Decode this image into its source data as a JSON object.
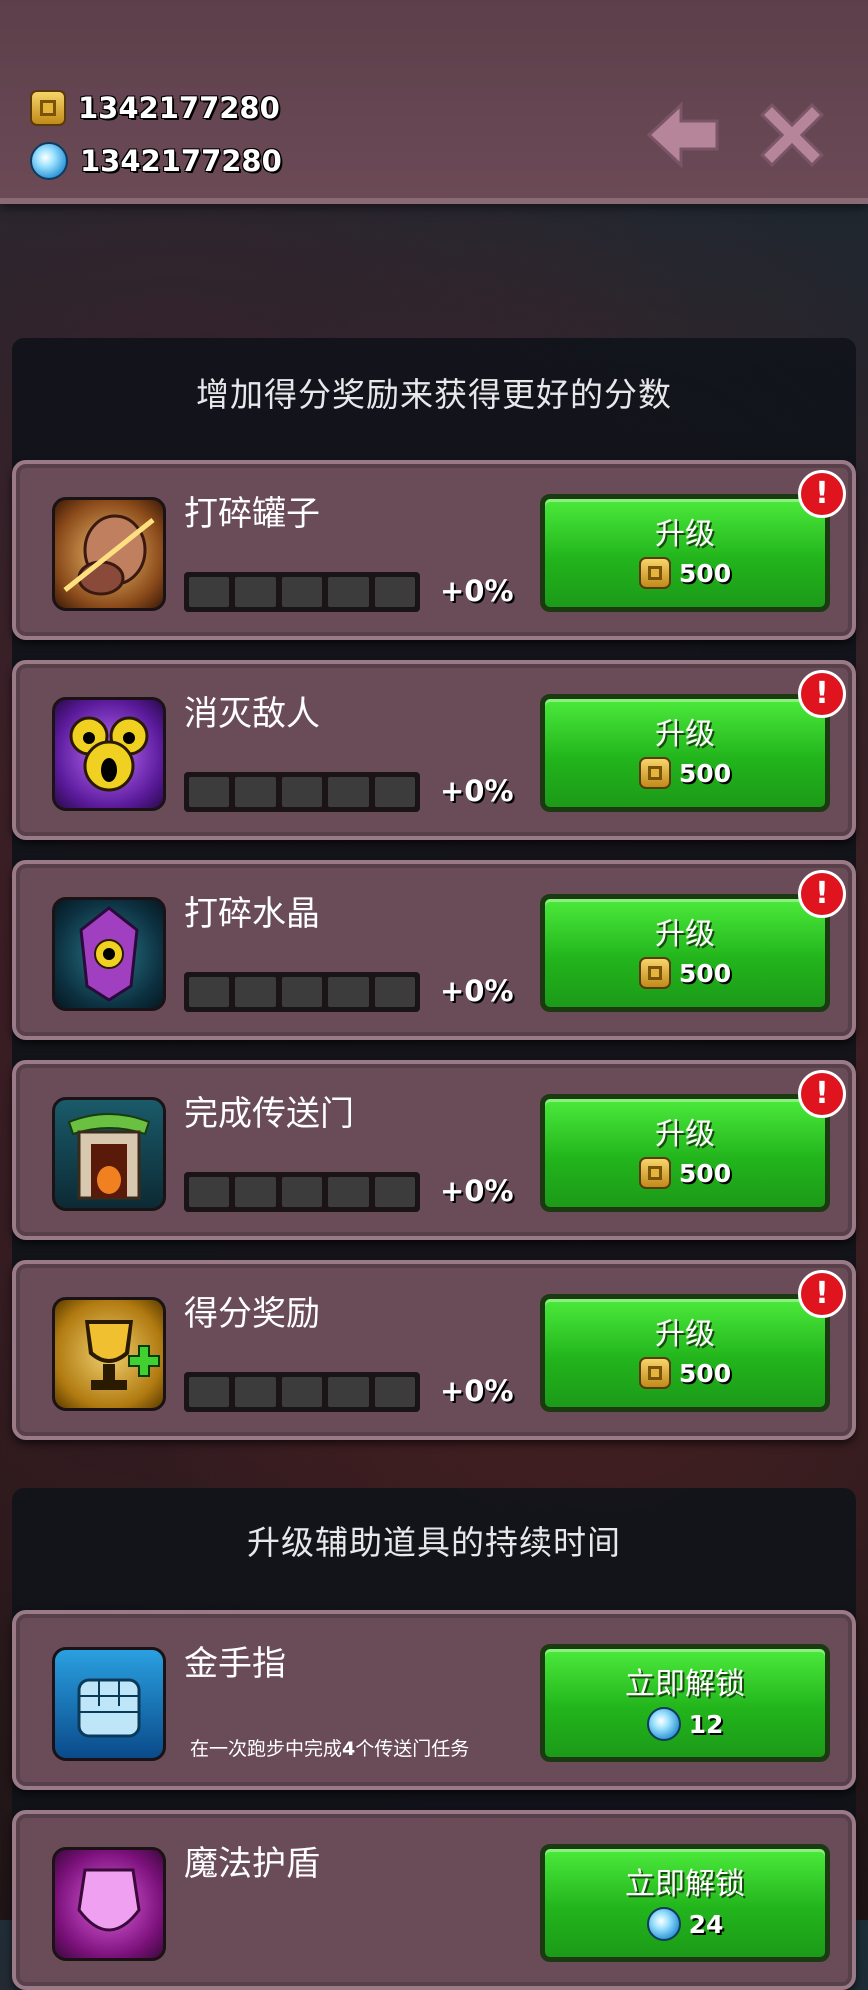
{
  "currencies": {
    "coins": "1342177280",
    "gems": "1342177280"
  },
  "sections": {
    "score": "增加得分奖励来获得更好的分数",
    "powerups": "升级辅助道具的持续时间"
  },
  "upgrades": [
    {
      "name": "打碎罐子",
      "pct": "+0%",
      "button": "升级",
      "cost": "500",
      "level": 0,
      "max_level": 5,
      "icon": "broken-jar-icon"
    },
    {
      "name": "消灭敌人",
      "pct": "+0%",
      "button": "升级",
      "cost": "500",
      "level": 0,
      "max_level": 5,
      "icon": "monster-eyes-icon"
    },
    {
      "name": "打碎水晶",
      "pct": "+0%",
      "button": "升级",
      "cost": "500",
      "level": 0,
      "max_level": 5,
      "icon": "crystal-eye-icon"
    },
    {
      "name": "完成传送门",
      "pct": "+0%",
      "button": "升级",
      "cost": "500",
      "level": 0,
      "max_level": 5,
      "icon": "portal-icon"
    },
    {
      "name": "得分奖励",
      "pct": "+0%",
      "button": "升级",
      "cost": "500",
      "level": 0,
      "max_level": 5,
      "icon": "trophy-plus-icon"
    }
  ],
  "powerups": [
    {
      "name": "金手指",
      "desc_prefix": "在一次跑步中完成",
      "desc_num": "4",
      "desc_suffix": "个传送门任务",
      "button": "立即解锁",
      "cost": "12",
      "icon": "fist-icon"
    },
    {
      "name": "魔法护盾",
      "button": "立即解锁",
      "cost": "24",
      "icon": "magic-shield-icon"
    }
  ],
  "badge_text": "!"
}
